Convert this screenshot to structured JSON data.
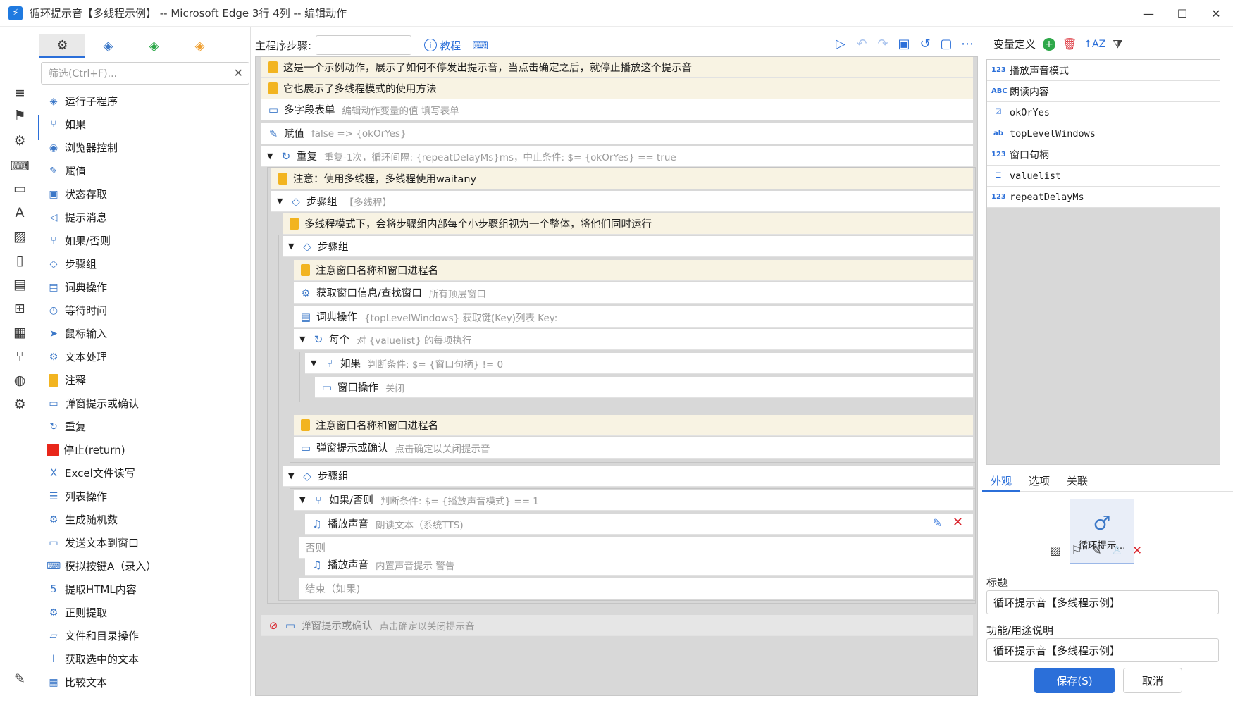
{
  "window": {
    "title": "循环提示音【多线程示例】 -- Microsoft Edge 3行 4列 -- 编辑动作",
    "minimize_icon": "—",
    "maximize_icon": "☐",
    "close_icon": "✕"
  },
  "rail": {
    "icons": [
      "menu-icon",
      "bookmark-icon",
      "gear-icon",
      "keyboard-icon",
      "window-icon",
      "font-icon",
      "image-icon",
      "clipboard-icon",
      "document-icon",
      "windows-icon",
      "table-icon",
      "branch-icon",
      "globe-icon",
      "settings-multi-icon"
    ],
    "bottom_icon": "wrench-icon"
  },
  "toolbox": {
    "tabs": [
      "gears-icon",
      "cubes-blue-icon",
      "cubes-green-icon",
      "cubes-orange-icon"
    ],
    "filter_placeholder": "筛选(Ctrl+F)...",
    "items": [
      {
        "label": "运行子程序",
        "icon": "cubes-icon"
      },
      {
        "label": "如果",
        "icon": "branch-icon"
      },
      {
        "label": "浏览器控制",
        "icon": "chrome-icon"
      },
      {
        "label": "赋值",
        "icon": "edit-icon"
      },
      {
        "label": "状态存取",
        "icon": "save-icon"
      },
      {
        "label": "提示消息",
        "icon": "megaphone-icon"
      },
      {
        "label": "如果/否则",
        "icon": "branch-icon"
      },
      {
        "label": "步骤组",
        "icon": "layers-icon"
      },
      {
        "label": "词典操作",
        "icon": "book-icon"
      },
      {
        "label": "等待时间",
        "icon": "timer-icon"
      },
      {
        "label": "鼠标输入",
        "icon": "cursor-icon"
      },
      {
        "label": "文本处理",
        "icon": "gear-icon"
      },
      {
        "label": "注释",
        "icon": "note-icon"
      },
      {
        "label": "弹窗提示或确认",
        "icon": "dialog-icon"
      },
      {
        "label": "重复",
        "icon": "loop-icon"
      },
      {
        "label": "停止(return)",
        "icon": "stop-icon"
      },
      {
        "label": "Excel文件读写",
        "icon": "excel-icon"
      },
      {
        "label": "列表操作",
        "icon": "list-icon"
      },
      {
        "label": "生成随机数",
        "icon": "gear-icon"
      },
      {
        "label": "发送文本到窗口",
        "icon": "message-icon"
      },
      {
        "label": "模拟按键A（录入）",
        "icon": "keyboard-icon"
      },
      {
        "label": "提取HTML内容",
        "icon": "html5-icon"
      },
      {
        "label": "正则提取",
        "icon": "gear-icon"
      },
      {
        "label": "文件和目录操作",
        "icon": "folder-icon"
      },
      {
        "label": "获取选中的文本",
        "icon": "text-cursor-icon"
      },
      {
        "label": "比较文本",
        "icon": "compare-icon"
      }
    ]
  },
  "main": {
    "label": "主程序步骤:",
    "help": "教程",
    "steps": [
      {
        "title": "这是一个示例动作，展示了如何不停发出提示音，当点击确定之后，就停止播放这个提示音",
        "desc": ""
      },
      {
        "title": "它也展示了多线程模式的使用方法",
        "desc": ""
      },
      {
        "title": "多字段表单",
        "desc": "编辑动作变量的值 填写表单"
      },
      {
        "title": "赋值",
        "desc": "false => {okOrYes}"
      },
      {
        "title": "重复",
        "desc": "重复-1次，循环间隔: {repeatDelayMs}ms，中止条件: $= {okOrYes} == true"
      },
      {
        "title": "注意：使用多线程，多线程使用waitany",
        "desc": ""
      },
      {
        "title": "步骤组",
        "desc": "【多线程】"
      },
      {
        "title": "多线程模式下，会将步骤组内部每个小步骤组视为一个整体，将他们同时运行",
        "desc": ""
      },
      {
        "title": "步骤组",
        "desc": ""
      },
      {
        "title": "注意窗口名称和窗口进程名",
        "desc": ""
      },
      {
        "title": "获取窗口信息/查找窗口",
        "desc": "所有顶层窗口"
      },
      {
        "title": "词典操作",
        "desc": "{topLevelWindows} 获取键(Key)列表 Key:"
      },
      {
        "title": "每个",
        "desc": "对 {valuelist} 的每项执行"
      },
      {
        "title": "如果",
        "desc": "判断条件: $= {窗口句柄} != 0"
      },
      {
        "title": "窗口操作",
        "desc": "关闭"
      },
      {
        "title": "注意窗口名称和窗口进程名",
        "desc": ""
      },
      {
        "title": "弹窗提示或确认",
        "desc": "点击确定以关闭提示音"
      },
      {
        "title": "步骤组",
        "desc": ""
      },
      {
        "title": "如果/否则",
        "desc": "判断条件: $= {播放声音模式} == 1"
      },
      {
        "title": "播放声音",
        "desc": "朗读文本（系统TTS)"
      },
      {
        "title": "否则",
        "desc": ""
      },
      {
        "title": "播放声音",
        "desc": "内置声音提示 警告"
      },
      {
        "title": "结束（如果)",
        "desc": ""
      },
      {
        "title": "弹窗提示或确认",
        "desc": "点击确定以关闭提示音"
      }
    ]
  },
  "variables": {
    "header": "变量定义",
    "items": [
      {
        "type": "123",
        "name": "播放声音模式"
      },
      {
        "type": "ABC",
        "name": "朗读内容"
      },
      {
        "type": "☑",
        "name": "okOrYes"
      },
      {
        "type": "ab",
        "name": "topLevelWindows"
      },
      {
        "type": "123",
        "name": "窗口句柄"
      },
      {
        "type": "☰",
        "name": "valuelist"
      },
      {
        "type": "123",
        "name": "repeatDelayMs"
      }
    ]
  },
  "props": {
    "tabs": [
      "外观",
      "选项",
      "关联"
    ],
    "card_caption": "循环提示...",
    "title_label": "标题",
    "title_value": "循环提示音【多线程示例】",
    "desc_label": "功能/用途说明",
    "desc_value": "循环提示音【多线程示例】",
    "save": "保存(S)",
    "cancel": "取消"
  }
}
